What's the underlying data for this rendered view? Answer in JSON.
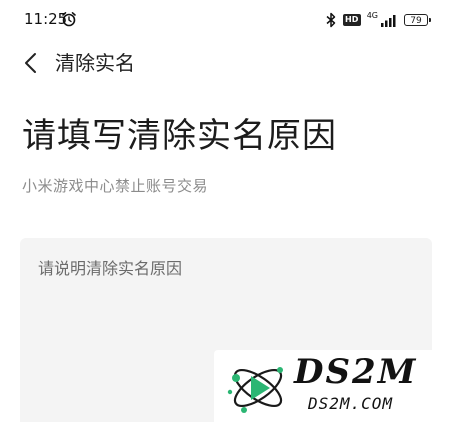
{
  "status_bar": {
    "time": "11:25",
    "hd_label": "HD",
    "network": "4G",
    "battery": "79"
  },
  "nav": {
    "title": "清除实名"
  },
  "main": {
    "heading": "请填写清除实名原因",
    "subtext": "小米游戏中心禁止账号交易",
    "reason_placeholder": "请说明清除实名原因",
    "reason_value": ""
  },
  "watermark": {
    "brand": "DS2M",
    "domain": "DS2M.COM"
  },
  "colors": {
    "background": "#ffffff",
    "input_background": "#f4f4f4",
    "subtext": "#8c8c8c",
    "logo_accent": "#2bb673"
  }
}
